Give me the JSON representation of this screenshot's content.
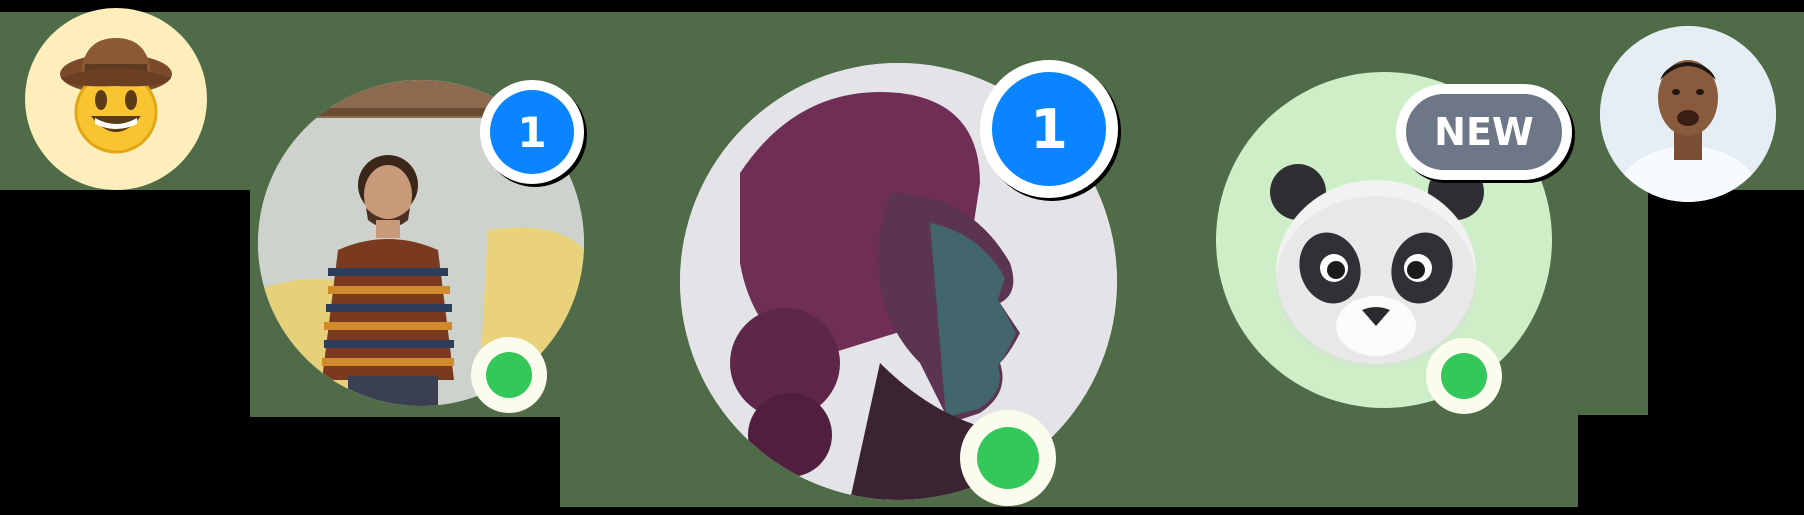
{
  "colors": {
    "background": "#000000",
    "band": "#4f6b47",
    "badge_blue": "#0a84ff",
    "badge_gray": "#6e7787",
    "badge_border": "#ffffff",
    "online_green": "#34c759",
    "status_ring": "#fbfbee",
    "emoji_bg": "#fdeebc",
    "panda_bg": "#cdeec7",
    "photo_bg": "#e8f1f7"
  },
  "avatars": [
    {
      "id": "cowboy",
      "icon": "cowboy-emoji-icon"
    },
    {
      "id": "man-sweater",
      "icon": "photo-icon",
      "badge": "1",
      "status": "online"
    },
    {
      "id": "woman-profile",
      "icon": "photo-icon",
      "badge": "1",
      "status": "online"
    },
    {
      "id": "panda",
      "icon": "panda-memoji-icon",
      "badge": "NEW",
      "status": "online"
    },
    {
      "id": "man-smiling",
      "icon": "photo-icon"
    }
  ]
}
